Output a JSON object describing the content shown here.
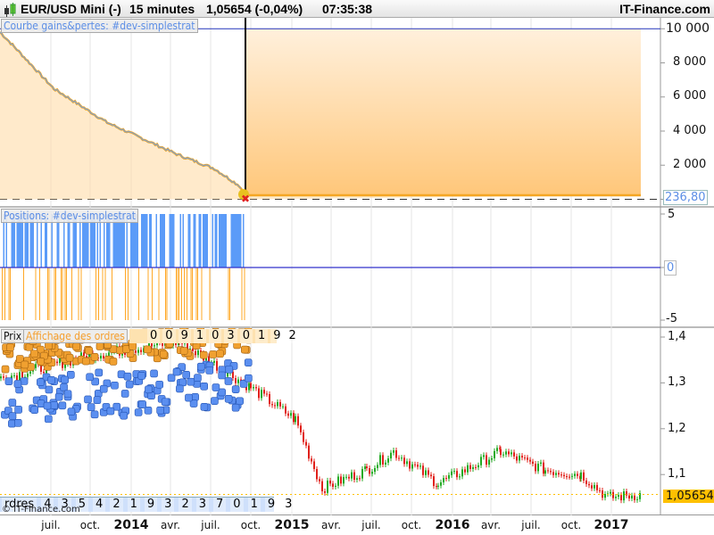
{
  "header": {
    "instrument": "EUR/USD Mini (-)",
    "timeframe": "15 minutes",
    "price": "1,05654 (-0,04%)",
    "time": "07:35:38",
    "brand": "IT-Finance.com"
  },
  "panels": {
    "equity": {
      "label": "Courbe gains&pertes: #dev-simplestrat",
      "y_ticks": [
        "10 000",
        "8 000",
        "6 000",
        "4 000",
        "2 000"
      ],
      "last_value": "236,80",
      "colors": {
        "fill": "#ffc77a",
        "line": "#f5a623"
      }
    },
    "positions": {
      "label": "Positions: #dev-simplestrat",
      "y_ticks": [
        "5",
        "0",
        "-5"
      ],
      "colors": {
        "long": "#5b9bf8",
        "short": "#ffa826"
      }
    },
    "price": {
      "tab_prix": "Prix",
      "tab_orders": "Affichage des ordres",
      "y_ticks": [
        "1,4",
        "1,3",
        "1,2",
        "1,1"
      ],
      "last_price": "1,05654",
      "order_counts_top": [
        "0",
        "0",
        "9",
        "1",
        "0",
        "3",
        "0",
        "1",
        "9",
        "2"
      ],
      "order_counts_bottom": [
        "rdres",
        "4",
        "3",
        "5",
        "4",
        "2",
        "1",
        "9",
        "3",
        "2",
        "3",
        "7",
        "0",
        "1",
        "9",
        "3"
      ],
      "watermark": "© IT-Finance.com",
      "colors": {
        "up": "#22aa22",
        "down": "#e0201a",
        "last": "#ffc000"
      }
    }
  },
  "x_axis": {
    "ticks": [
      "juil.",
      "oct.",
      "2014",
      "avr.",
      "juil.",
      "oct.",
      "2015",
      "avr.",
      "juil.",
      "oct.",
      "2016",
      "avr.",
      "juil.",
      "oct.",
      "2017"
    ]
  },
  "chart_data": {
    "type": "line",
    "equity_curve": {
      "ylim": [
        0,
        10000
      ],
      "x": [
        "2013-06",
        "2013-07",
        "2013-09",
        "2014-01",
        "2014-04",
        "2014-07",
        "2014-09",
        "2014-09-20",
        "2017-02"
      ],
      "values": [
        9800,
        9000,
        6500,
        4500,
        2500,
        1500,
        700,
        236.8,
        236.8
      ]
    },
    "price": {
      "ylim": [
        1.03,
        1.42
      ],
      "x": [
        "2013-06",
        "2014-01",
        "2014-05",
        "2014-09",
        "2015-01",
        "2015-03",
        "2015-05",
        "2015-08",
        "2015-12",
        "2016-05",
        "2016-08",
        "2016-11",
        "2017-01",
        "2017-02"
      ],
      "values": [
        1.31,
        1.36,
        1.39,
        1.29,
        1.22,
        1.07,
        1.11,
        1.15,
        1.08,
        1.15,
        1.11,
        1.1,
        1.05,
        1.0565
      ]
    }
  }
}
